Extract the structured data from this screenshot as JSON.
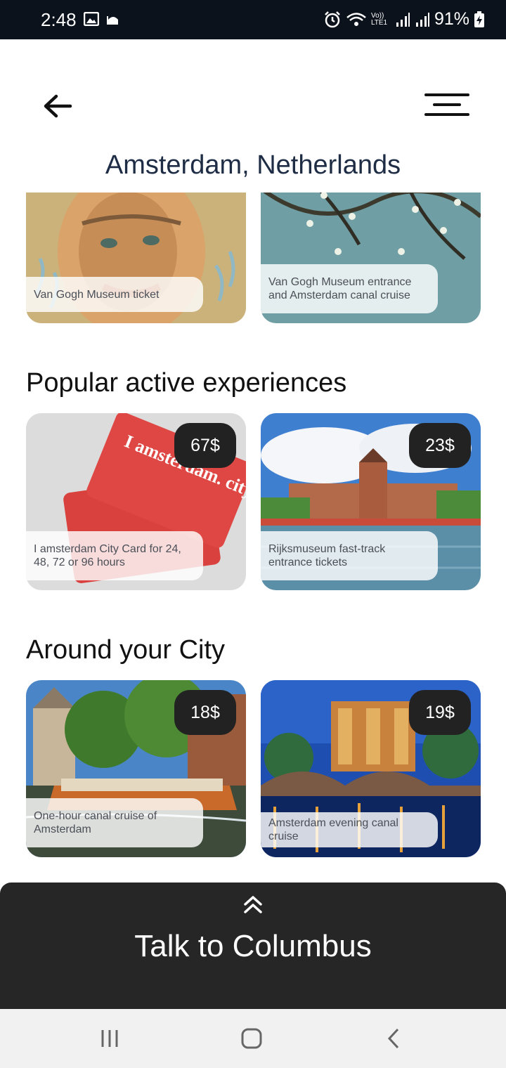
{
  "status_bar": {
    "time": "2:48",
    "battery": "91%",
    "left_icons": [
      "image-icon",
      "mosque-icon"
    ],
    "right_icons": [
      "alarm-icon",
      "wifi-calling-icon",
      "signal-icon",
      "signal-icon",
      "battery-charging-icon"
    ],
    "network": "Vo)) LTE1"
  },
  "header": {
    "back_icon": "arrow-left-icon",
    "menu_icon": "hamburger-menu-icon",
    "title": "Amsterdam, Netherlands"
  },
  "sections": [
    {
      "title": "",
      "cards": [
        {
          "price": "",
          "label": "Van Gogh Museum ticket"
        },
        {
          "price": "",
          "label": "Van Gogh Museum entrance and Amsterdam canal cruise"
        }
      ]
    },
    {
      "title": "Popular active experiences",
      "cards": [
        {
          "price": "67$",
          "label": "I amsterdam City Card for 24, 48, 72 or 96 hours",
          "card_text": "I amsterdam. city card"
        },
        {
          "price": "23$",
          "label": "Rijksmuseum fast-track entrance tickets"
        }
      ]
    },
    {
      "title": "Around your City",
      "cards": [
        {
          "price": "18$",
          "label": "One-hour canal cruise of Amsterdam"
        },
        {
          "price": "19$",
          "label": "Amsterdam evening canal cruise"
        }
      ]
    }
  ],
  "bottom_sheet": {
    "icon": "double-chevron-up-icon",
    "title": "Talk to Columbus"
  },
  "nav_bar": {
    "items": [
      "recent-apps-icon",
      "home-icon",
      "back-icon"
    ]
  },
  "colors": {
    "status_bar": "#0b121b",
    "title_text": "#1e2d45",
    "price_badge": "#222222",
    "bottom_sheet": "#262626",
    "nav_bar": "#f1f1f1"
  }
}
